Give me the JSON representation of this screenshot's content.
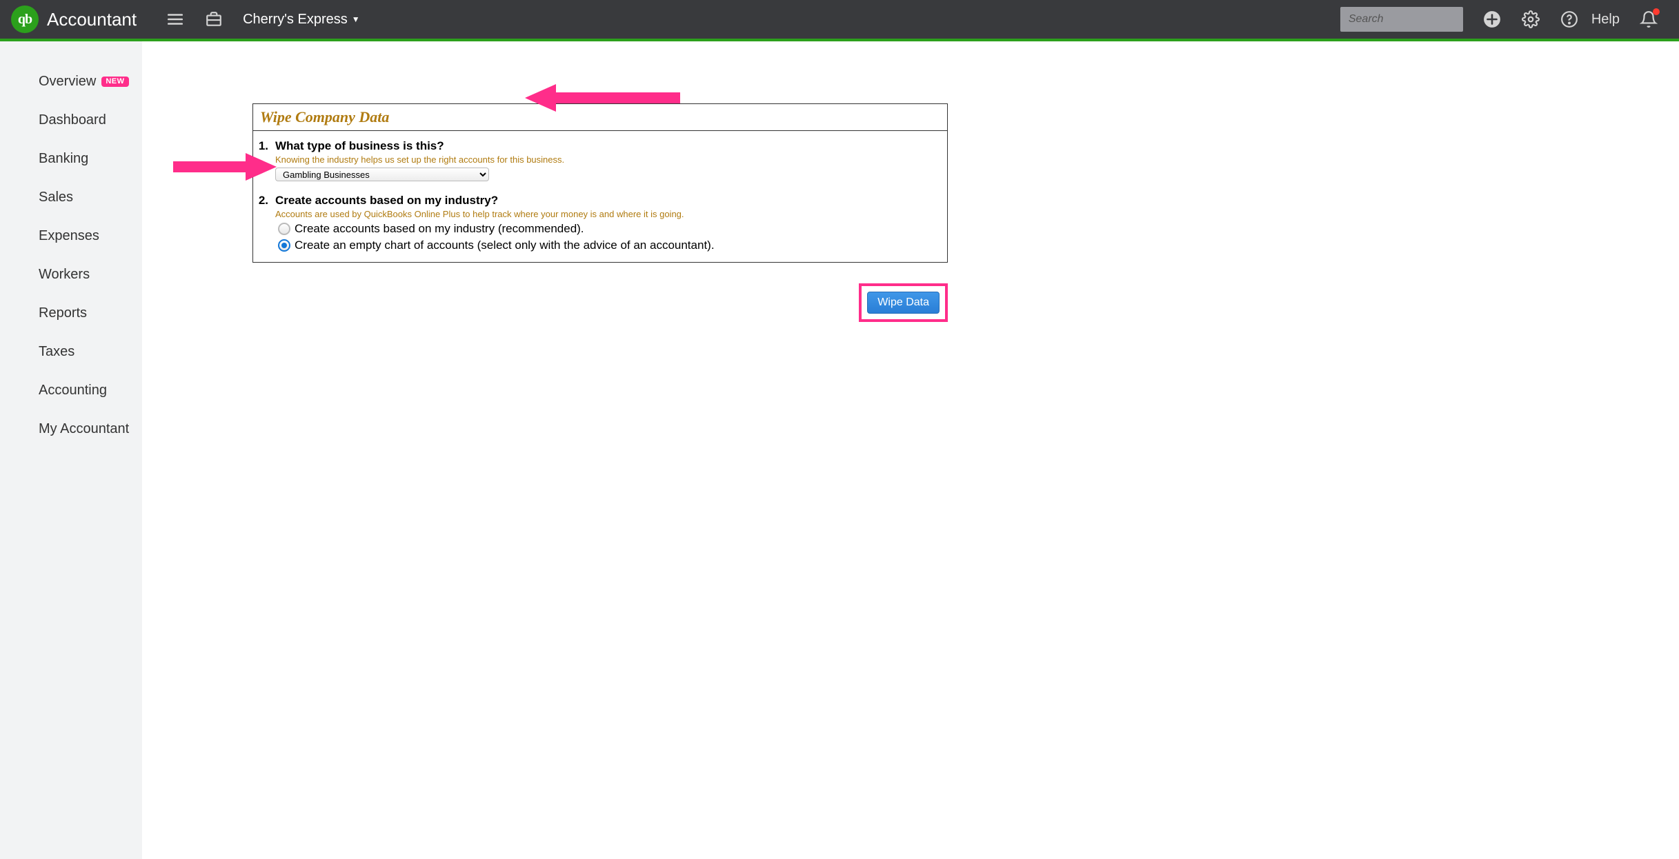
{
  "header": {
    "brand": "Accountant",
    "logo_text": "qb",
    "company_name": "Cherry's Express",
    "search_placeholder": "Search",
    "help_label": "Help"
  },
  "sidebar": {
    "items": [
      {
        "label": "Overview",
        "badge": "NEW"
      },
      {
        "label": "Dashboard",
        "badge": null
      },
      {
        "label": "Banking",
        "badge": null
      },
      {
        "label": "Sales",
        "badge": null
      },
      {
        "label": "Expenses",
        "badge": null
      },
      {
        "label": "Workers",
        "badge": null
      },
      {
        "label": "Reports",
        "badge": null
      },
      {
        "label": "Taxes",
        "badge": null
      },
      {
        "label": "Accounting",
        "badge": null
      },
      {
        "label": "My Accountant",
        "badge": null
      }
    ]
  },
  "panel": {
    "title": "Wipe Company Data",
    "q1": {
      "num": "1.",
      "title": "What type of business is this?",
      "help": "Knowing the industry helps us set up the right accounts for this business.",
      "selected": "Gambling Businesses"
    },
    "q2": {
      "num": "2.",
      "title": "Create accounts based on my industry?",
      "help": "Accounts are used by QuickBooks Online Plus to help track where your money is and where it is going.",
      "opt1": "Create accounts based on my industry (recommended).",
      "opt2": "Create an empty chart of accounts (select only with the advice of an accountant).",
      "selected_index": 1
    }
  },
  "actions": {
    "wipe_label": "Wipe Data"
  }
}
